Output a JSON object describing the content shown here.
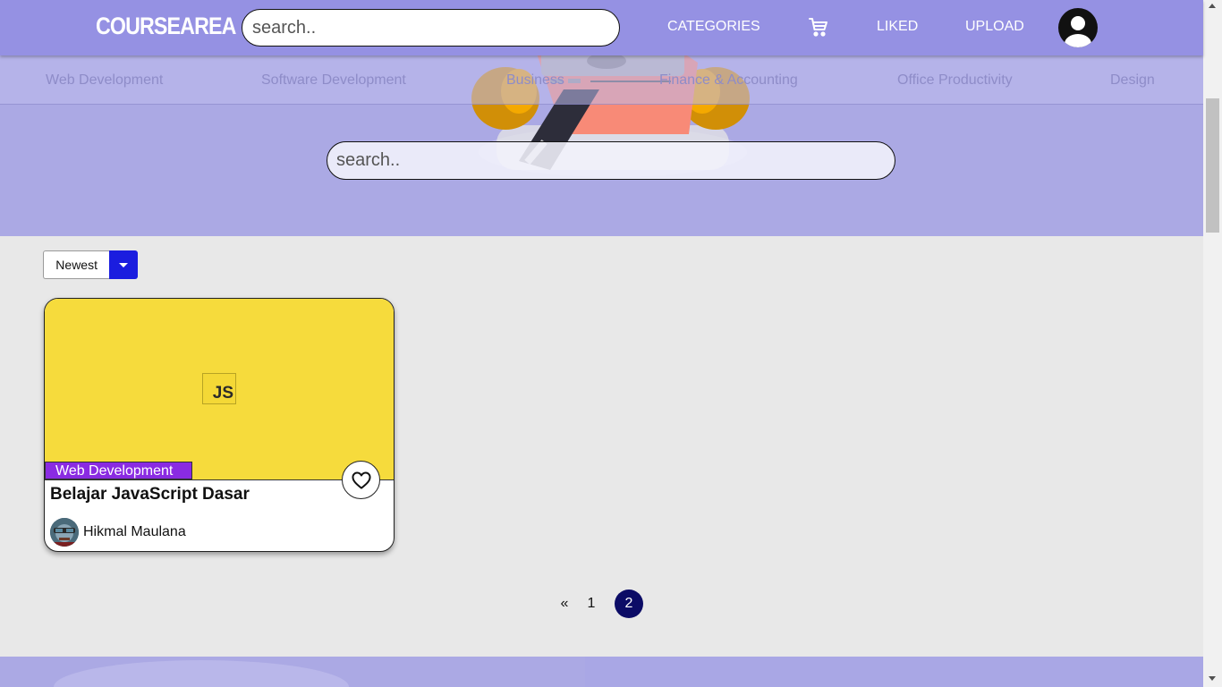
{
  "nav": {
    "logo": "COURSEAREA",
    "search_placeholder": "search..",
    "categories": "CATEGORIES",
    "cart_icon": "cart-icon",
    "liked": "LIKED",
    "upload": "UPLOAD",
    "avatar_icon": "user-avatar-icon"
  },
  "category_strip": [
    "Web Development",
    "Software Development",
    "Business",
    "Finance & Accounting",
    "Office Productivity",
    "Design"
  ],
  "hero": {
    "search_placeholder": "search.."
  },
  "sort": {
    "selected": "Newest"
  },
  "courses": [
    {
      "category": "Web Development",
      "title": "Belajar JavaScript Dasar",
      "author": "Hikmal Maulana",
      "thumb_label": "JS",
      "thumb_color": "#f6db3c",
      "category_color": "#8a2be2"
    }
  ],
  "pagination": {
    "prev": "«",
    "pages": [
      "1",
      "2"
    ],
    "current": "2"
  },
  "colors": {
    "nav": "#9591e3",
    "hero": "#aba9e4",
    "sort_button": "#1b1ddf",
    "page_active": "#0c0c66"
  }
}
